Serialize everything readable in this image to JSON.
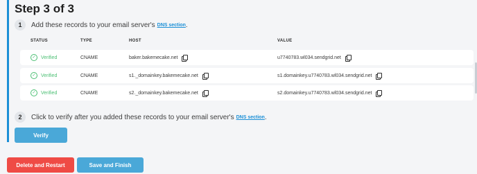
{
  "step_title": "Step 3 of 3",
  "instructions": [
    {
      "number": "1",
      "text": "Add these records to your email server's",
      "link": "DNS section",
      "suffix": "."
    },
    {
      "number": "2",
      "text": "Click to verify after you added these records to your email server's",
      "link": "DNS section",
      "suffix": "."
    }
  ],
  "table": {
    "headers": {
      "status": "STATUS",
      "type": "TYPE",
      "host": "HOST",
      "value": "VALUE"
    },
    "rows": [
      {
        "status": "Verified",
        "type": "CNAME",
        "host": "baker.bakemecake.net",
        "value": "u7740783.wl034.sendgrid.net"
      },
      {
        "status": "Verified",
        "type": "CNAME",
        "host": "s1._domainkey.bakemecake.net",
        "value": "s1.domainkey.u7740783.wl034.sendgrid.net"
      },
      {
        "status": "Verified",
        "type": "CNAME",
        "host": "s2._domainkey.bakemecake.net",
        "value": "s2.domainkey.u7740783.wl034.sendgrid.net"
      }
    ]
  },
  "buttons": {
    "verify": "Verify",
    "delete_restart": "Delete and Restart",
    "save_finish": "Save and Finish"
  },
  "colors": {
    "accent": "#1b8fd6",
    "verified": "#4bbf73",
    "danger": "#ef4b45",
    "primary_button": "#4aa8d8"
  },
  "icons": {
    "status": "check-circle-icon",
    "copy": "copy-icon"
  }
}
